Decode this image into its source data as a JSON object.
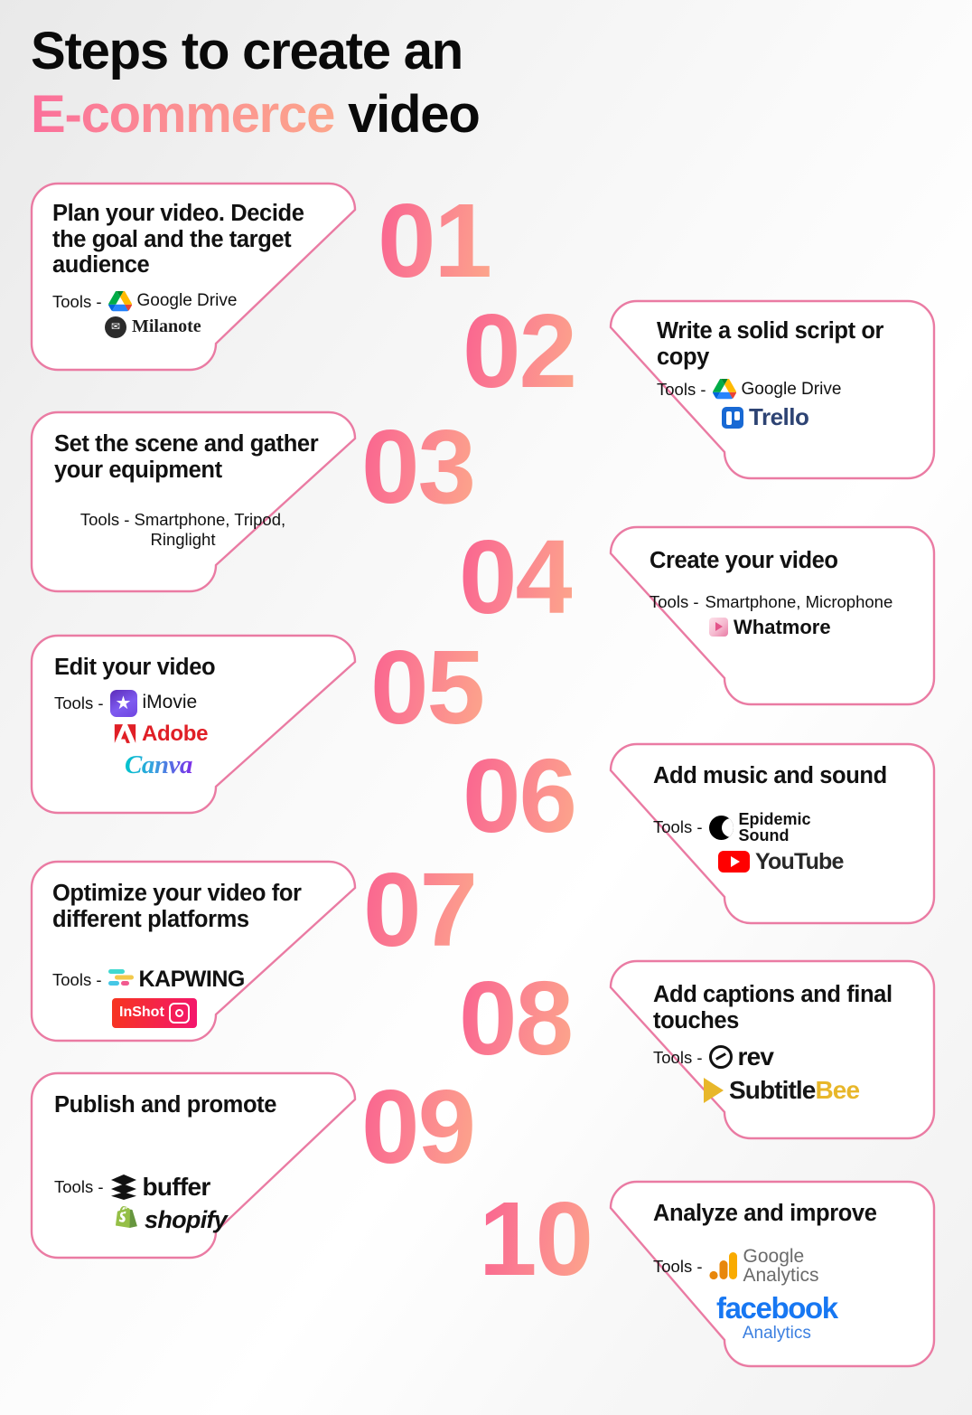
{
  "title": {
    "line1": "Steps to create an",
    "line2_accent": "E-commerce",
    "line2_rest": " video"
  },
  "colors": {
    "accent_pink": "#f9628f",
    "accent_salmon": "#fca68b",
    "card_border": "#ea7ba3",
    "card_bg": "#ffffff"
  },
  "steps": [
    {
      "number": "01",
      "side": "left",
      "title": "Plan your video. Decide the goal and the target audience",
      "tools_label": "Tools -",
      "tools": [
        {
          "name": "Google Drive",
          "icon": "google-drive-icon"
        },
        {
          "name": "Milanote",
          "icon": "milanote-icon"
        }
      ]
    },
    {
      "number": "02",
      "side": "right",
      "title": "Write a solid script or copy",
      "tools_label": "Tools -",
      "tools": [
        {
          "name": "Google Drive",
          "icon": "google-drive-icon"
        },
        {
          "name": "Trello",
          "icon": "trello-icon"
        }
      ]
    },
    {
      "number": "03",
      "side": "left",
      "title": "Set the scene and gather your equipment",
      "tools_label": "Tools - Smartphone, Tripod,",
      "tools_label_2": "Ringlight",
      "tools": []
    },
    {
      "number": "04",
      "side": "right",
      "title": "Create your video",
      "tools_label": "Tools -",
      "tools_text": "Smartphone, Microphone",
      "tools": [
        {
          "name": "Whatmore",
          "icon": "whatmore-icon"
        }
      ]
    },
    {
      "number": "05",
      "side": "left",
      "title": "Edit your video",
      "tools_label": "Tools -",
      "tools": [
        {
          "name": "iMovie",
          "icon": "imovie-icon"
        },
        {
          "name": "Adobe",
          "icon": "adobe-icon"
        },
        {
          "name": "Canva",
          "icon": "canva-icon"
        }
      ]
    },
    {
      "number": "06",
      "side": "right",
      "title": "Add music and sound",
      "tools_label": "Tools -",
      "tools": [
        {
          "name": "Epidemic Sound",
          "name_line1": "Epidemic",
          "name_line2": "Sound",
          "icon": "epidemic-sound-icon"
        },
        {
          "name": "YouTube",
          "icon": "youtube-icon"
        }
      ]
    },
    {
      "number": "07",
      "side": "left",
      "title": "Optimize your video for different platforms",
      "tools_label": "Tools -",
      "tools": [
        {
          "name": "KAPWING",
          "icon": "kapwing-icon"
        },
        {
          "name": "InShot",
          "icon": "inshot-icon"
        }
      ]
    },
    {
      "number": "08",
      "side": "right",
      "title": "Add captions and final touches",
      "tools_label": "Tools -",
      "tools": [
        {
          "name": "rev",
          "icon": "rev-icon"
        },
        {
          "name": "SubtitleBee",
          "name_part1": "Subtitle",
          "name_part2": "Bee",
          "icon": "subtitlebee-icon"
        }
      ]
    },
    {
      "number": "09",
      "side": "left",
      "title": "Publish and promote",
      "tools_label": "Tools -",
      "tools": [
        {
          "name": "buffer",
          "icon": "buffer-icon"
        },
        {
          "name": "shopify",
          "icon": "shopify-icon"
        }
      ]
    },
    {
      "number": "10",
      "side": "right",
      "title": "Analyze and improve",
      "tools_label": "Tools -",
      "tools": [
        {
          "name": "Google Analytics",
          "name_line1": "Google",
          "name_line2": "Analytics",
          "icon": "google-analytics-icon"
        },
        {
          "name": "facebook Analytics",
          "name_line1": "facebook",
          "name_line2": "Analytics",
          "icon": "facebook-analytics-icon"
        }
      ]
    }
  ]
}
